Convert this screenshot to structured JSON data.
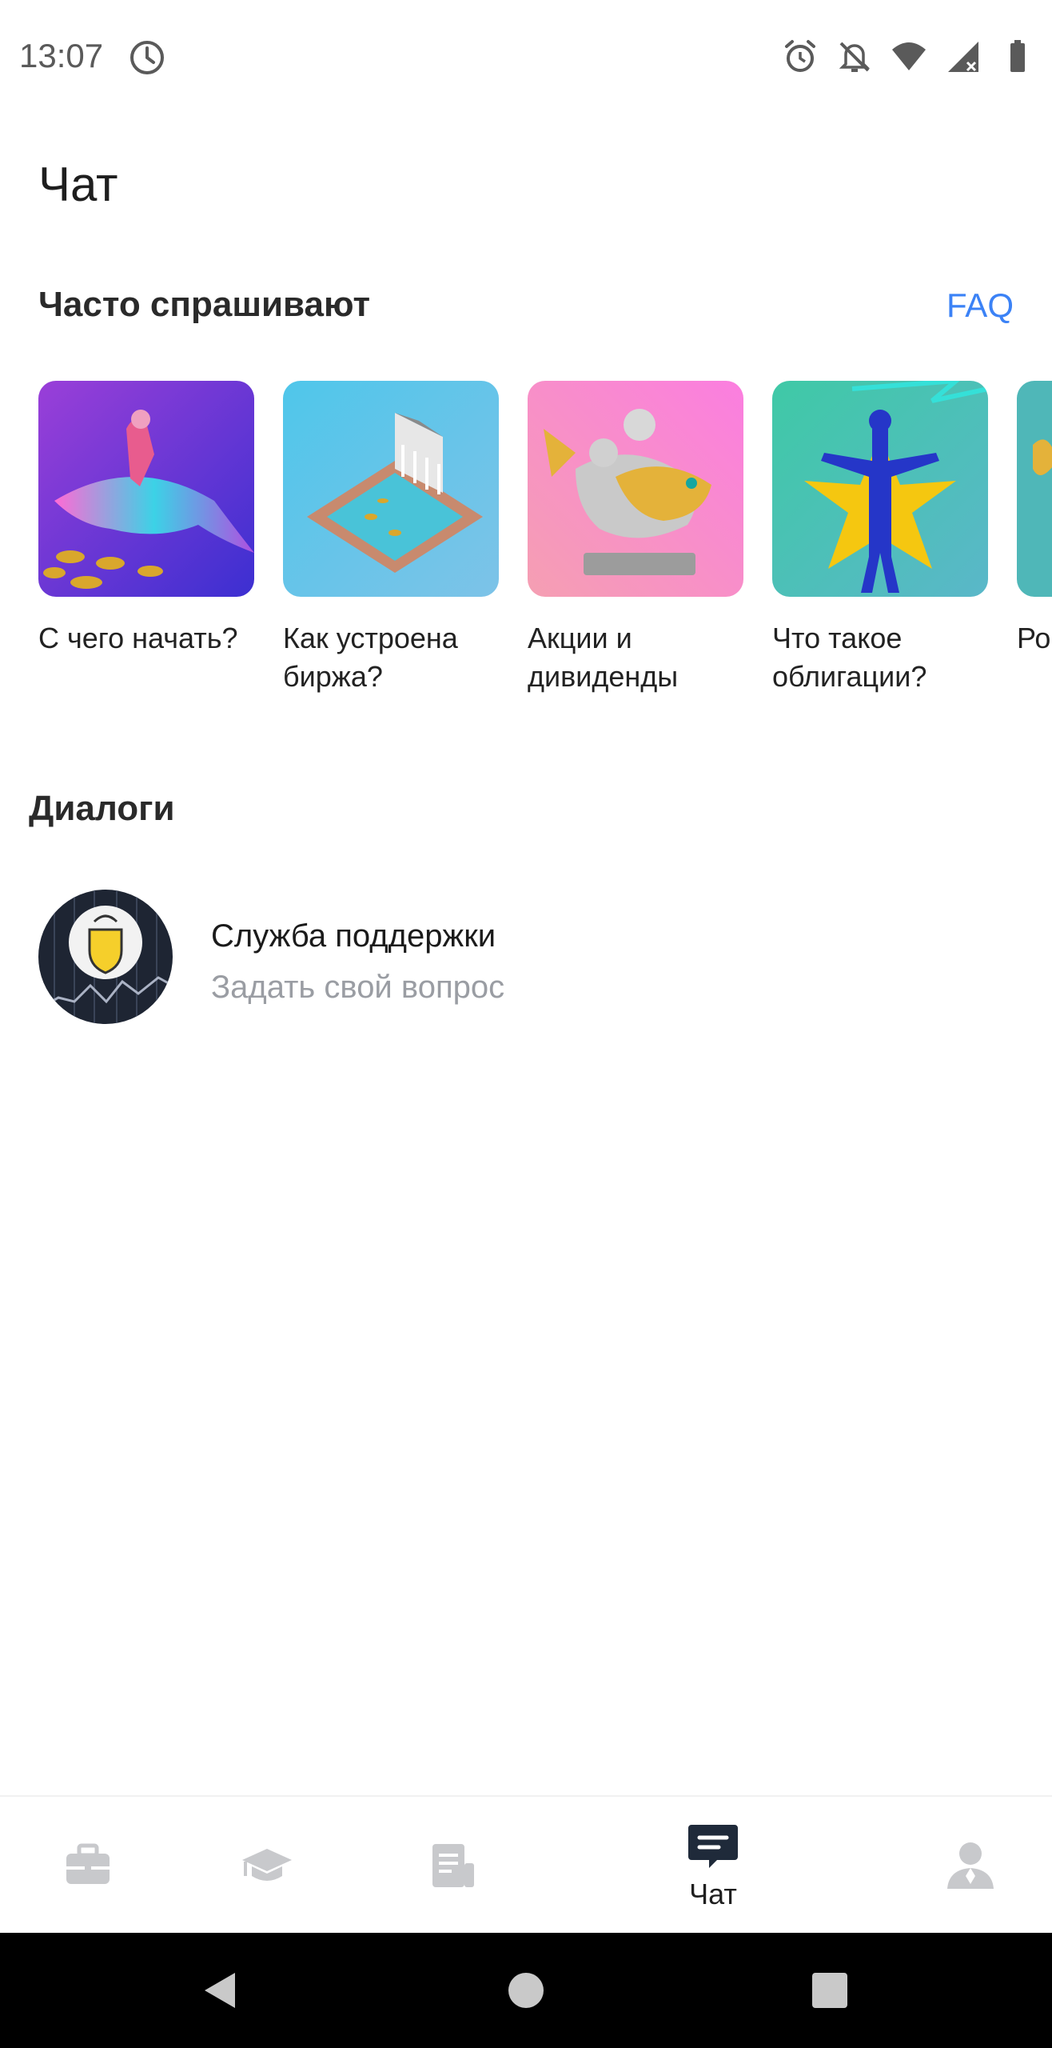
{
  "status_bar": {
    "time": "13:07",
    "icons": [
      "clock-icon",
      "alarm-icon",
      "notifications-off-icon",
      "wifi-icon",
      "signal-icon",
      "battery-icon"
    ]
  },
  "page": {
    "title": "Чат"
  },
  "faq": {
    "title": "Часто спрашивают",
    "link_label": "FAQ",
    "cards": [
      {
        "label": "С чего начать?",
        "image": "dolphin-rider-image"
      },
      {
        "label": "Как устроена\nбиржа?",
        "image": "exchange-building-image"
      },
      {
        "label": "Акции и\nдивиденды",
        "image": "fish-statue-image"
      },
      {
        "label": "Что такое\nоблигации?",
        "image": "zeus-star-image"
      },
      {
        "label": "Ро",
        "image": "partial-card-image"
      }
    ]
  },
  "dialogs": {
    "title": "Диалоги",
    "items": [
      {
        "name": "Служба поддержки",
        "subtitle": "Задать свой вопрос"
      }
    ]
  },
  "bottom_nav": {
    "items": [
      {
        "icon": "briefcase-icon",
        "label": ""
      },
      {
        "icon": "graduation-cap-icon",
        "label": ""
      },
      {
        "icon": "news-document-icon",
        "label": ""
      },
      {
        "icon": "chat-icon",
        "label": "Чат",
        "active": true
      },
      {
        "icon": "profile-icon",
        "label": ""
      }
    ]
  },
  "colors": {
    "accent": "#3b82f6",
    "nav_active": "#1f2a3a",
    "nav_inactive": "#c8c9cc",
    "muted_text": "#9a9da3"
  }
}
